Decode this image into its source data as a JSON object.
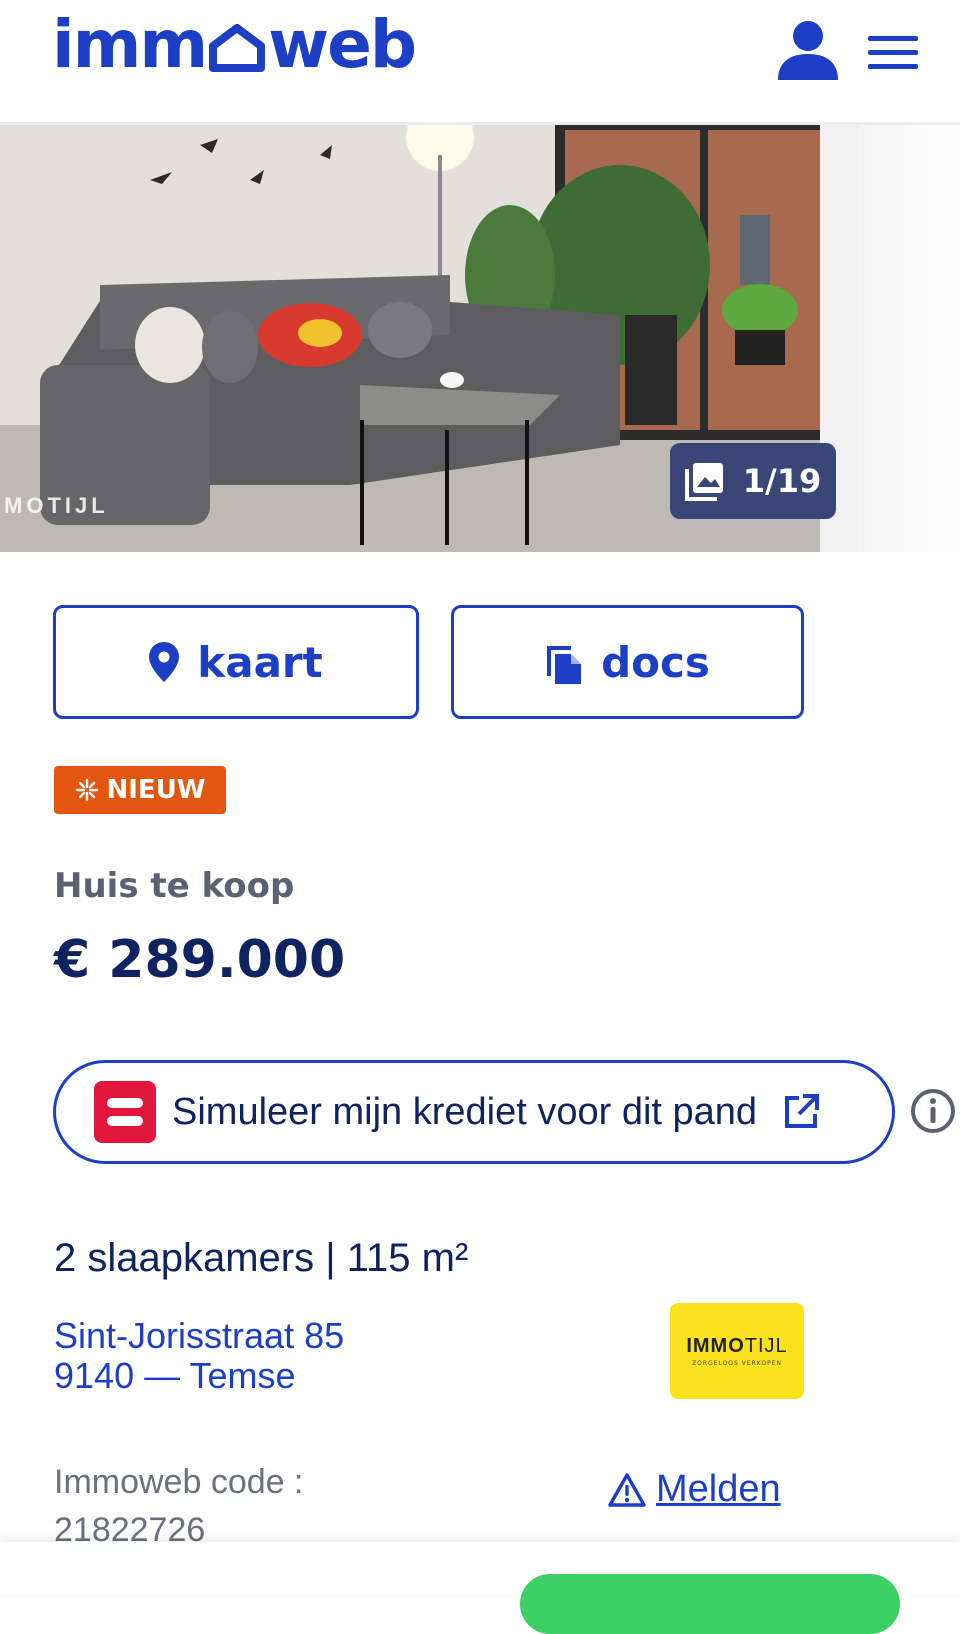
{
  "header": {
    "logo_text_left": "imm",
    "logo_text_right": "web"
  },
  "gallery": {
    "counter": "1/19",
    "watermark": "MOTIJL"
  },
  "actions": {
    "map_label": "kaart",
    "docs_label": "docs"
  },
  "badge": {
    "label": "NIEUW",
    "color": "#e4560f"
  },
  "listing": {
    "type": "Huis te koop",
    "price": "€ 289.000",
    "specs": "2 slaapkamers | 115 m²",
    "address_line1": "Sint-Jorisstraat 85",
    "address_line2": "9140 — Temse",
    "code_label": "Immoweb code :",
    "code_value": "21822726",
    "report_label": "Melden"
  },
  "credit": {
    "label": "Simuleer mijn krediet voor dit pand"
  },
  "agency": {
    "name_bold": "IMMO",
    "name_thin": "TIJL",
    "tagline": "ZORGELOOS VERKOPEN",
    "color": "#fbe21d"
  },
  "colors": {
    "brand_blue": "#1d3fc6",
    "navy": "#0f2360"
  }
}
